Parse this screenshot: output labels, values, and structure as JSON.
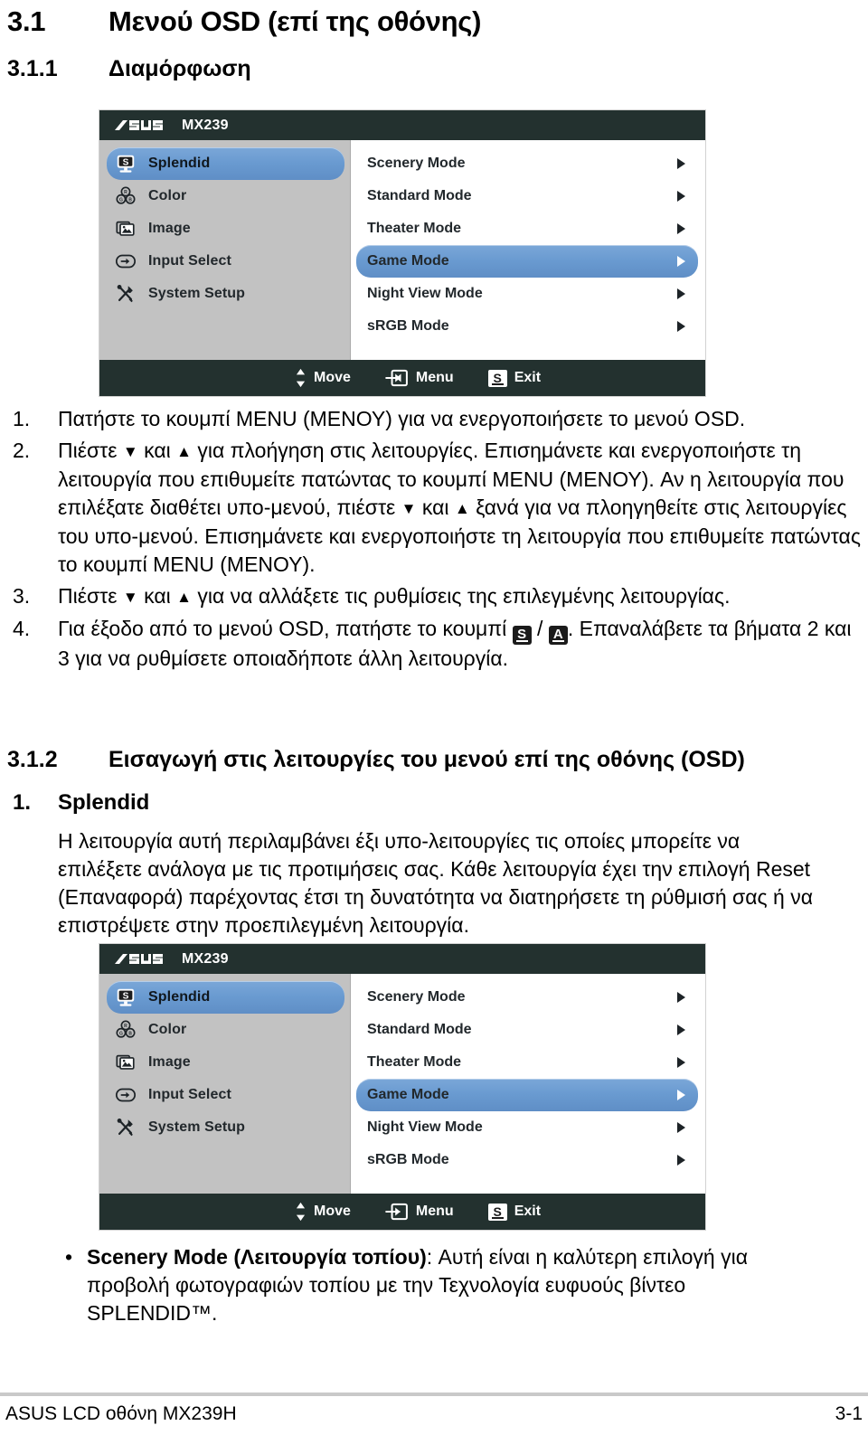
{
  "document": {
    "heading_1": {
      "number": "3.1",
      "text": "Μενού OSD (επί της οθόνης)"
    },
    "heading_2": {
      "number": "3.1.1",
      "text": "Διαμόρφωση"
    },
    "heading_3": {
      "number": "3.1.2",
      "text": "Εισαγωγή στις λειτουργίες του μενού επί της οθόνης (OSD)"
    },
    "splendid_section": {
      "number": "1.",
      "title": "Splendid"
    },
    "splendid_paragraph": "Η λειτουργία αυτή περιλαμβάνει έξι υπο-λειτουργίες τις οποίες μπορείτε να επιλέξετε ανάλογα με τις προτιμήσεις σας. Κάθε λειτουργία έχει την επιλογή Reset (Επαναφορά) παρέχοντας έτσι τη δυνατότητα να διατηρήσετε τη ρύθμισή σας ή να επιστρέψετε στην προεπιλεγμένη λειτουργία.",
    "steps": [
      {
        "number": "1.",
        "parts": [
          {
            "type": "text",
            "value": "Πατήστε το κουμπί MENU (ΜΕΝΟΥ) για να ενεργοποιήσετε το μενού OSD."
          }
        ]
      },
      {
        "number": "2.",
        "parts": [
          {
            "type": "text",
            "value": "Πιέστε "
          },
          {
            "type": "glyph",
            "value": "▼"
          },
          {
            "type": "text",
            "value": " και "
          },
          {
            "type": "glyph",
            "value": "▲"
          },
          {
            "type": "text",
            "value": " για πλοήγηση στις λειτουργίες. Επισημάνετε και ενεργοποιήστε τη λειτουργία που επιθυμείτε πατώντας το κουμπί MENU (ΜΕΝΟΥ). Αν η λειτουργία που επιλέξατε διαθέτει υπο-μενού, πιέστε "
          },
          {
            "type": "glyph",
            "value": "▼"
          },
          {
            "type": "text",
            "value": " και "
          },
          {
            "type": "glyph",
            "value": "▲"
          },
          {
            "type": "text",
            "value": " ξανά για να πλοηγηθείτε στις λειτουργίες του υπο-μενού. Επισημάνετε και ενεργοποιήστε τη λειτουργία που επιθυμείτε πατώντας το κουμπί MENU (ΜΕΝΟΥ)."
          }
        ]
      },
      {
        "number": "3.",
        "parts": [
          {
            "type": "text",
            "value": "Πιέστε "
          },
          {
            "type": "glyph",
            "value": "▼"
          },
          {
            "type": "text",
            "value": " και "
          },
          {
            "type": "glyph",
            "value": "▲"
          },
          {
            "type": "text",
            "value": " για να αλλάξετε τις ρυθμίσεις της επιλεγμένης λειτουργίας."
          }
        ]
      },
      {
        "number": "4.",
        "parts": [
          {
            "type": "text",
            "value": "Για έξοδο από το μενού OSD, πατήστε το κουμπί "
          },
          {
            "type": "key",
            "value": "S"
          },
          {
            "type": "text",
            "value": " / "
          },
          {
            "type": "key",
            "value": "A"
          },
          {
            "type": "text",
            "value": ". Επαναλάβετε τα βήματα 2 και 3 για να ρυθμίσετε οποιαδήποτε άλλη λειτουργία."
          }
        ]
      }
    ],
    "bullet": {
      "marker": "•",
      "bold_label": "Scenery Mode (Λειτουργία τοπίου)",
      "rest": ": Αυτή είναι η καλύτερη επιλογή για προβολή φωτογραφιών τοπίου με την Τεχνολογία ευφυούς βίντεο SPLENDID™."
    },
    "footer": {
      "left": "ASUS LCD οθόνη MX239H",
      "right": "3-1"
    }
  },
  "osd": {
    "brand": "ASUS",
    "model": "MX239",
    "sidebar": [
      {
        "label": "Splendid",
        "icon": "splendid-monitor-icon",
        "selected": true
      },
      {
        "label": "Color",
        "icon": "color-rgb-icon",
        "selected": false
      },
      {
        "label": "Image",
        "icon": "image-photos-icon",
        "selected": false
      },
      {
        "label": "Input Select",
        "icon": "input-arrow-icon",
        "selected": false
      },
      {
        "label": "System Setup",
        "icon": "tools-wrench-screwdriver-icon",
        "selected": false
      }
    ],
    "options": [
      {
        "label": "Scenery Mode",
        "selected": false
      },
      {
        "label": "Standard Mode",
        "selected": false
      },
      {
        "label": "Theater Mode",
        "selected": false
      },
      {
        "label": "Game Mode",
        "selected": true
      },
      {
        "label": "Night View Mode",
        "selected": false
      },
      {
        "label": "sRGB Mode",
        "selected": false
      }
    ],
    "footer_actions": [
      {
        "label": "Move",
        "icon": "up-down-arrows-icon"
      },
      {
        "label": "Menu",
        "icon": "menu-enter-icon"
      },
      {
        "label": "Exit",
        "icon": "splendid-s-button-icon"
      }
    ],
    "colors": {
      "title_bar": "#23312f",
      "sidebar_bg": "#c2c2c2",
      "panel_bg": "#ffffff",
      "highlight": "#6a9bd1",
      "text": "#22282c"
    }
  }
}
